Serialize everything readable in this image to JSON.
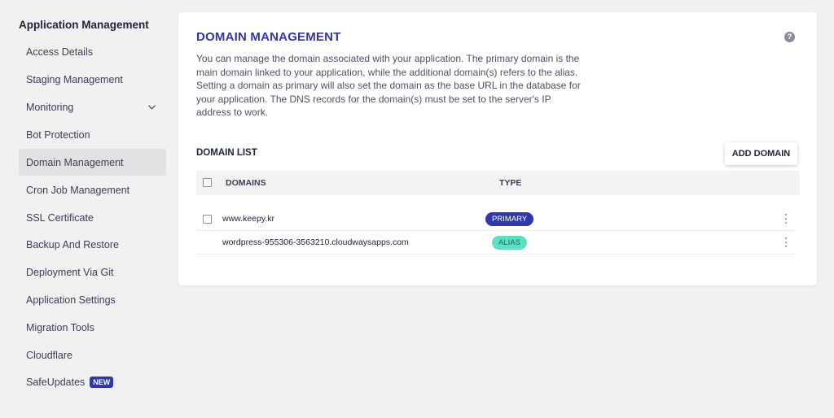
{
  "sidebar": {
    "title": "Application Management",
    "items": [
      {
        "label": "Access Details"
      },
      {
        "label": "Staging Management"
      },
      {
        "label": "Monitoring"
      },
      {
        "label": "Bot Protection"
      },
      {
        "label": "Domain Management"
      },
      {
        "label": "Cron Job Management"
      },
      {
        "label": "SSL Certificate"
      },
      {
        "label": "Backup And Restore"
      },
      {
        "label": "Deployment Via Git"
      },
      {
        "label": "Application Settings"
      },
      {
        "label": "Migration Tools"
      },
      {
        "label": "Cloudflare"
      },
      {
        "label": "SafeUpdates",
        "badge": "NEW"
      }
    ],
    "active_item": "Domain Management",
    "expandable_item": "Monitoring"
  },
  "main": {
    "title": "DOMAIN MANAGEMENT",
    "help_icon": "?",
    "description": "You can manage the domain associated with your application. The primary domain is the main domain linked to your application, while the additional domain(s) refers to the alias. Setting a domain as primary will also set the domain as the base URL in the database for your application. The DNS records for the domain(s) must be set to the server's IP address to work.",
    "list_title": "DOMAIN LIST",
    "add_button": "ADD DOMAIN",
    "table": {
      "headers": [
        "DOMAINS",
        "TYPE"
      ],
      "rows": [
        {
          "domain": "www.keepy.kr",
          "type": "PRIMARY",
          "has_checkbox": true
        },
        {
          "domain": "wordpress-955306-3563210.cloudwaysapps.com",
          "type": "ALIAS",
          "has_checkbox": false
        }
      ]
    }
  },
  "colors": {
    "accent": "#2f38a4",
    "primary_badge": "#2f38a4",
    "alias_badge": "#5fe0c4",
    "background": "#f1f1f2",
    "active_item_bg": "#e2e2e4"
  },
  "icons": {
    "monitoring_expand": "chevron-down-icon",
    "help": "help-icon",
    "row_menu": "kebab-menu-icon"
  }
}
